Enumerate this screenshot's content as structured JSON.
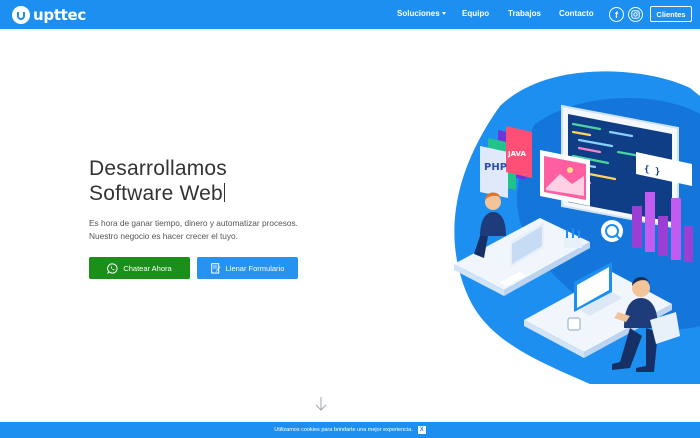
{
  "brand": {
    "name": "upttec"
  },
  "nav": {
    "items": [
      {
        "label": "Soluciones",
        "dropdown": true
      },
      {
        "label": "Equipo"
      },
      {
        "label": "Trabajos"
      },
      {
        "label": "Contacto"
      }
    ],
    "social": [
      {
        "icon": "facebook-icon",
        "glyph": "f"
      },
      {
        "icon": "instagram-icon",
        "glyph": "◎"
      }
    ],
    "clientes_label": "Clientes"
  },
  "hero": {
    "headline_line1": "Desarrollamos",
    "headline_line2": "Software Web",
    "description": "Es hora de ganar tiempo, dinero y automatizar procesos. Nuestro negocio es hacer crecer el tuyo.",
    "primary_button": "Chatear Ahora",
    "secondary_button": "Llenar Formulario",
    "illustration_labels": [
      "PHP",
      "JAVA",
      "{ }"
    ]
  },
  "cookie": {
    "text": "Utilizamos cookies para brindarte una mejor experiencia.",
    "close": "X"
  },
  "colors": {
    "primary": "#1d8ff0",
    "whatsapp_green": "#1a8f1a",
    "text_dark": "#333333"
  }
}
